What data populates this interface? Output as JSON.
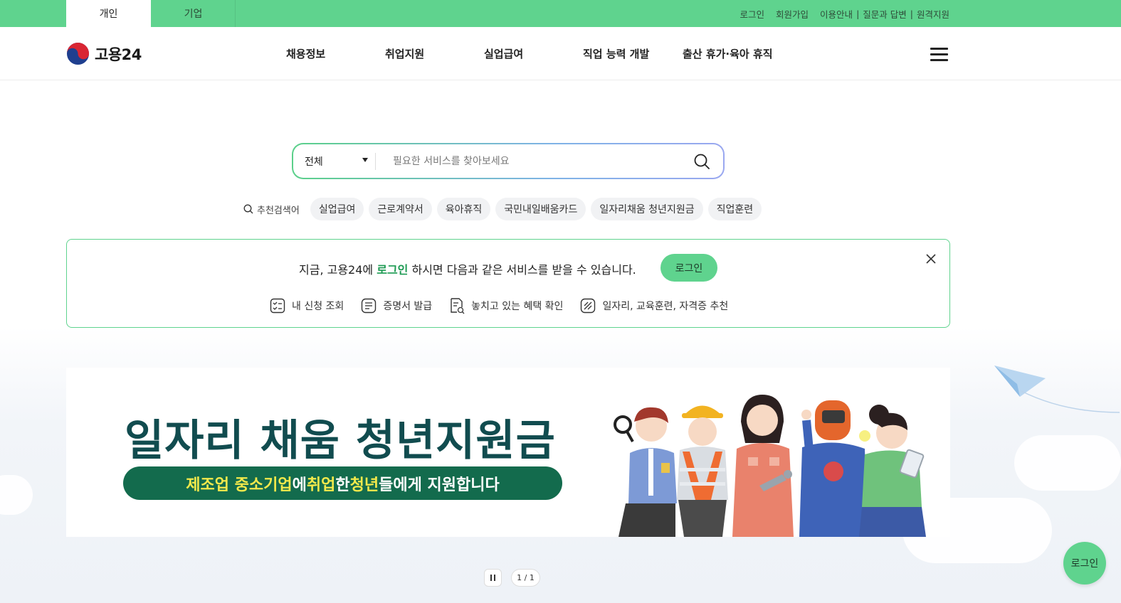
{
  "utility": {
    "tabs": [
      {
        "label": "개인",
        "active": true
      },
      {
        "label": "기업",
        "active": false
      }
    ],
    "links": [
      "로그인",
      "회원가입",
      "이용안내",
      "질문과 답변",
      "원격지원"
    ],
    "separator": "|"
  },
  "header": {
    "logo_text": "고용24",
    "nav": [
      "채용정보",
      "취업지원",
      "실업급여",
      "직업 능력 개발",
      "출산 휴가·육아 휴직"
    ],
    "menu_icon": "hamburger-icon"
  },
  "search": {
    "category": "전체",
    "placeholder": "필요한 서비스를 찾아보세요",
    "value": ""
  },
  "keywords": {
    "label": "추천검색어",
    "items": [
      "실업급여",
      "근로계약서",
      "육아휴직",
      "국민내일배움카드",
      "일자리채움 청년지원금",
      "직업훈련"
    ]
  },
  "notice": {
    "msg_before": "지금, 고용24에 ",
    "msg_highlight": "로그인",
    "msg_after": " 하시면 다음과 같은 서비스를 받을 수 있습니다.",
    "login_button": "로그인",
    "services": [
      {
        "label": "내 신청 조회",
        "icon": "checklist-icon"
      },
      {
        "label": "증명서 발급",
        "icon": "certificate-icon"
      },
      {
        "label": "놓치고 있는 혜택 확인",
        "icon": "benefit-search-icon"
      },
      {
        "label": "일자리, 교육훈련, 자격증 추천",
        "icon": "recommend-icon"
      }
    ]
  },
  "banner": {
    "title": "일자리 채움 청년지원금",
    "sub_1": "제조업 중소기업",
    "sub_2": "에 ",
    "sub_3": "취업",
    "sub_4": "한 ",
    "sub_5": "청년",
    "sub_6": "들에게 지원합니다"
  },
  "pager": {
    "count": "1 / 1"
  },
  "float_login": "로그인",
  "colors": {
    "brand_green": "#5fd38e",
    "banner_title": "#114c4f",
    "banner_pill": "#136b4d",
    "highlight_yellow": "#f3e94b"
  }
}
